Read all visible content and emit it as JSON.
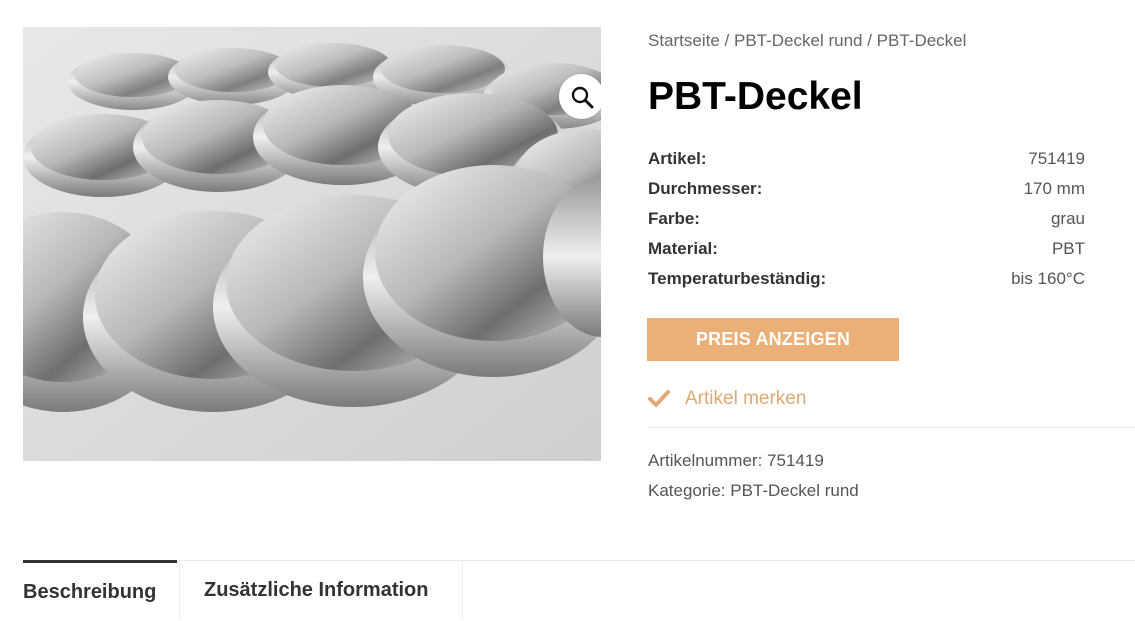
{
  "image": {
    "description_icon": "zoom-icon"
  },
  "breadcrumb": {
    "items": [
      "Startseite",
      "PBT-Deckel rund",
      "PBT-Deckel"
    ],
    "separator": " / "
  },
  "product": {
    "title": "PBT-Deckel"
  },
  "specs": [
    {
      "label": "Artikel:",
      "value": "751419"
    },
    {
      "label": "Durchmesser:",
      "value": "170 mm"
    },
    {
      "label": "Farbe:",
      "value": "grau"
    },
    {
      "label": "Material:",
      "value": "PBT"
    },
    {
      "label": "Temperaturbeständig:",
      "value": "bis 160°C"
    }
  ],
  "actions": {
    "price_button": "PREIS ANZEIGEN",
    "wishlist_label": "Artikel merken"
  },
  "meta": {
    "sku_label": "Artikelnummer:",
    "sku_value": "751419",
    "category_label": "Kategorie:",
    "category_value": "PBT-Deckel rund"
  },
  "tabs": [
    {
      "label": "Beschreibung",
      "active": true
    },
    {
      "label": "Zusätzliche Information",
      "active": false
    }
  ],
  "colors": {
    "accent": "#ebb077",
    "wishlist": "#e0a873"
  }
}
